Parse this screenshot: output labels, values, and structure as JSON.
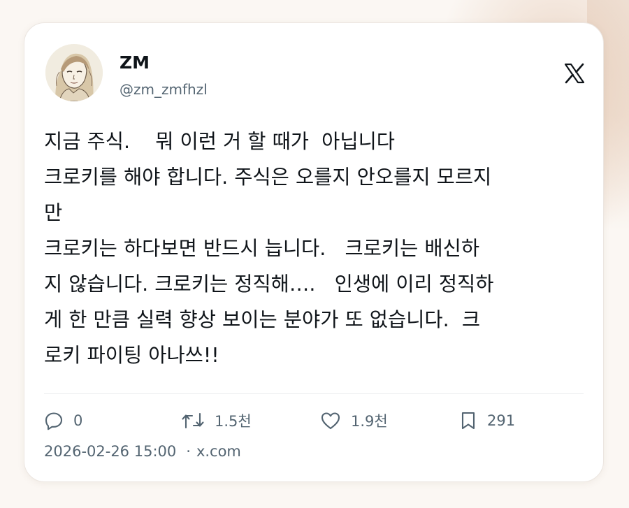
{
  "author": {
    "name": "ZM",
    "handle": "@zm_zmfhzl",
    "avatar_icon": "avatar-illustration"
  },
  "platform_icon": "x-logo-icon",
  "tweet": {
    "lines": [
      "지금 주식.    뭐 이런 거 할 때가  아닙니다",
      "크로키를 해야 합니다. 주식은 오를지 안오를지 모르지",
      "만",
      "크로키는 하다보면 반드시 늡니다.   크로키는 배신하",
      "지 않습니다. 크로키는 정직해….   인생에 이리 정직하",
      "게 한 만큼 실력 향상 보이는 분야가 또 없습니다.  크",
      "로키 파이팅 아나쓰!!"
    ]
  },
  "actions": {
    "reply": {
      "icon": "reply-icon",
      "count": "0"
    },
    "retweet": {
      "icon": "retweet-icon",
      "count": "1.5천"
    },
    "like": {
      "icon": "heart-icon",
      "count": "1.9천"
    },
    "bookmark": {
      "icon": "bookmark-icon",
      "count": "291"
    }
  },
  "meta": {
    "timestamp": "2026-02-26 15:00",
    "separator": "·",
    "source": "x.com"
  },
  "colors": {
    "text_primary": "#0f1419",
    "text_secondary": "#536471",
    "card_background": "#ffffff",
    "page_background": "#fbf7f3"
  }
}
